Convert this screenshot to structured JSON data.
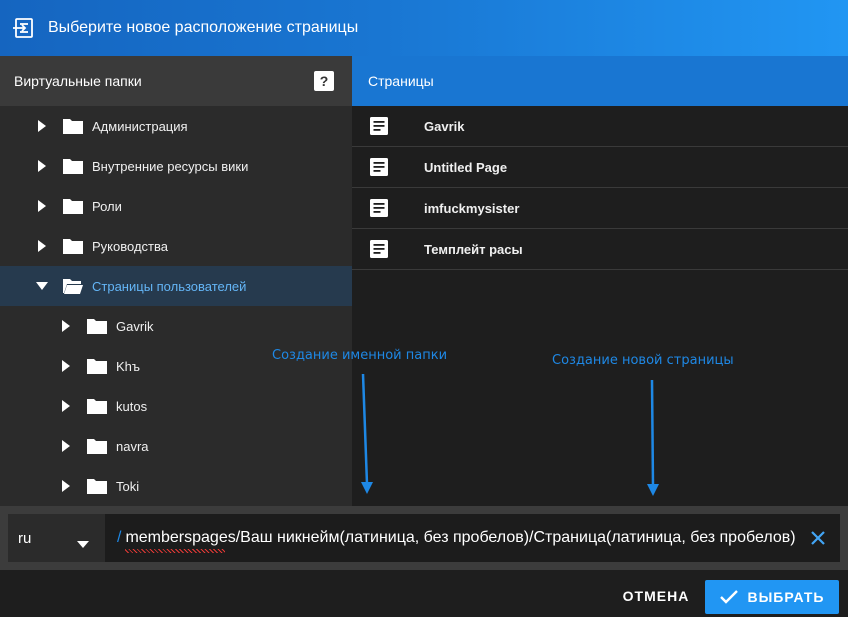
{
  "dialog": {
    "title": "Выберите новое расположение страницы"
  },
  "left": {
    "header": "Виртуальные папки",
    "help_label": "?",
    "tree": [
      {
        "label": "Администрация",
        "expanded": false,
        "level": 0,
        "selected": false
      },
      {
        "label": "Внутренние ресурсы вики",
        "expanded": false,
        "level": 0,
        "selected": false
      },
      {
        "label": "Роли",
        "expanded": false,
        "level": 0,
        "selected": false
      },
      {
        "label": "Руководства",
        "expanded": false,
        "level": 0,
        "selected": false
      },
      {
        "label": "Страницы пользователей",
        "expanded": true,
        "level": 0,
        "selected": true
      },
      {
        "label": "Gavrik",
        "expanded": false,
        "level": 1,
        "selected": false
      },
      {
        "label": "Khъ",
        "expanded": false,
        "level": 1,
        "selected": false
      },
      {
        "label": "kutos",
        "expanded": false,
        "level": 1,
        "selected": false
      },
      {
        "label": "navra",
        "expanded": false,
        "level": 1,
        "selected": false
      },
      {
        "label": "Toki",
        "expanded": false,
        "level": 1,
        "selected": false
      }
    ]
  },
  "right": {
    "header": "Страницы",
    "pages": [
      "Gavrik",
      "Untitled Page",
      "imfuckmysister",
      "Темплейт расы"
    ]
  },
  "annotations": {
    "folder_note": "Создание именной папки",
    "page_note": "Создание новой страницы"
  },
  "pathbar": {
    "locale": "ru",
    "slash": "/",
    "path": "memberspages/Ваш никнейм(латиница, без пробелов)/Страница(латиница, без пробелов)"
  },
  "footer": {
    "cancel_label": "ОТМЕНА",
    "select_label": "ВЫБРАТЬ"
  },
  "colors": {
    "accent": "#2196f3",
    "header_blue": "#1976d2",
    "annotation": "#1e88e5"
  },
  "icons": [
    "move-page-icon",
    "help-icon",
    "chevron-right-icon",
    "chevron-down-icon",
    "folder-icon",
    "folder-open-icon",
    "page-icon",
    "caret-down-icon",
    "close-icon",
    "check-icon"
  ]
}
